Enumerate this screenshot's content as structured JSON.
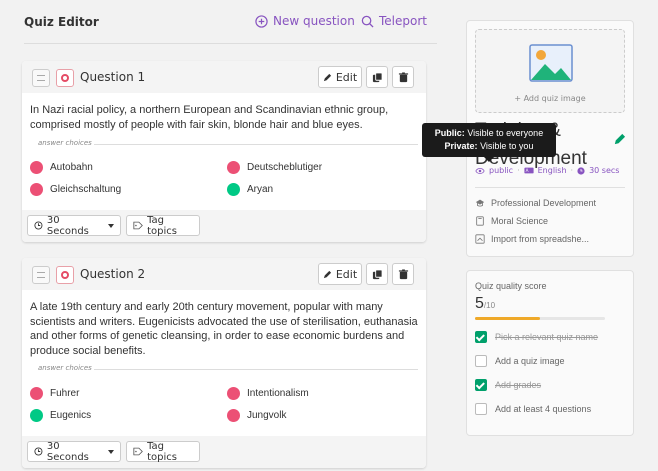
{
  "header": {
    "title": "Quiz Editor",
    "new_question": "New question",
    "teleport": "Teleport"
  },
  "questions": [
    {
      "label": "Question 1",
      "edit": "Edit",
      "text": "In Nazi racial policy, a northern European and Scandinavian ethnic group, comprised mostly of people with fair skin, blonde hair and blue eyes.",
      "answer_choices_label": "answer choices",
      "choices": [
        {
          "text": "Autobahn",
          "correct": false
        },
        {
          "text": "Deutscheblutiger",
          "correct": false
        },
        {
          "text": "Gleichschaltung",
          "correct": false
        },
        {
          "text": "Aryan",
          "correct": true
        }
      ],
      "time": "30 Seconds",
      "tag": "Tag topics"
    },
    {
      "label": "Question 2",
      "edit": "Edit",
      "text": "A late 19th century and early 20th century movement, popular with many scientists and writers. Eugenicists advocated the use of sterilisation, euthanasia and other forms of genetic cleansing, in order to ease economic burdens and produce social benefits.",
      "answer_choices_label": "answer choices",
      "choices": [
        {
          "text": "Fuhrer",
          "correct": false
        },
        {
          "text": "Intentionalism",
          "correct": false
        },
        {
          "text": "Eugenics",
          "correct": true
        },
        {
          "text": "Jungvolk",
          "correct": false
        }
      ],
      "time": "30 Seconds",
      "tag": "Tag topics"
    }
  ],
  "sidebar": {
    "add_image": "+ Add quiz image",
    "quiz_title": "Training & Development",
    "visibility": "public",
    "language": "English",
    "time": "30 secs",
    "tooltip": {
      "public_label": "Public:",
      "public_text": "Visible to everyone",
      "private_label": "Private:",
      "private_text": "Visible to you"
    },
    "details": [
      {
        "icon": "graduation-cap-icon",
        "text": "Professional Development"
      },
      {
        "icon": "book-icon",
        "text": "Moral Science"
      },
      {
        "icon": "import-icon",
        "text": "Import from spreadshe..."
      }
    ]
  },
  "quality": {
    "label": "Quiz quality score",
    "score": "5",
    "max": "/10",
    "progress": 0.5,
    "items": [
      {
        "text": "Pick a relevant quiz name",
        "done": true
      },
      {
        "text": "Add a quiz image",
        "done": false
      },
      {
        "text": "Add grades",
        "done": true
      },
      {
        "text": "Add at least 4 questions",
        "done": false
      }
    ]
  },
  "colors": {
    "accent": "#8854c0",
    "wrong": "#ec5075",
    "correct": "#00c985",
    "progress": "#efa929"
  }
}
